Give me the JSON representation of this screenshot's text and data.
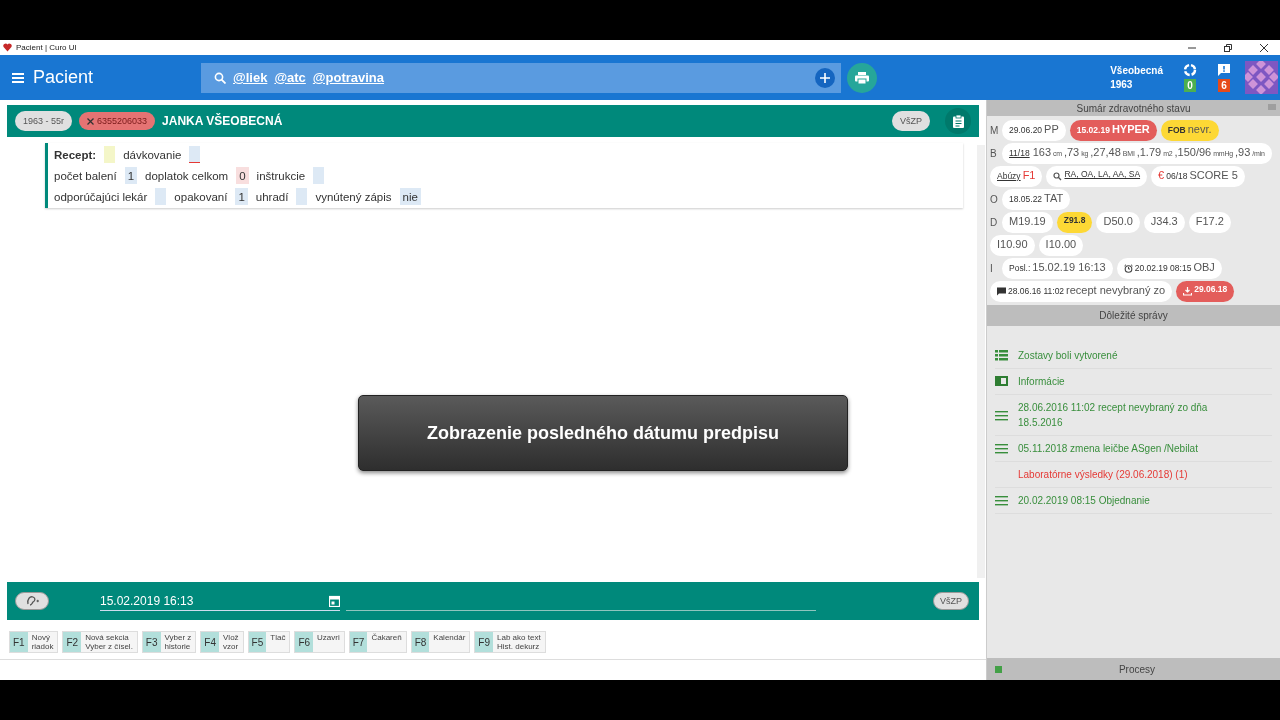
{
  "window": {
    "title": "Pacient | Curo UI"
  },
  "header": {
    "title": "Pacient",
    "search_tags": [
      "@liek",
      "@atc",
      "@potravina"
    ],
    "user_name": "Všeobecná",
    "user_year": "1963",
    "sync_count": "0",
    "message_count": "6"
  },
  "patient": {
    "age": "1963 - 55r",
    "id": "6355206033",
    "name": "JANKA VŠEOBECNÁ",
    "insurer": "VšZP"
  },
  "recept": [
    [
      {
        "label": "Recept:",
        "strong": true,
        "color": "#f4f6c8"
      },
      {
        "label": "dávkovanie",
        "strong": false,
        "color": "#dde9f5",
        "error": true
      }
    ],
    [
      {
        "label": "počet balení",
        "strong": false,
        "value": "1",
        "color": "#dde9f5"
      },
      {
        "label": "doplatok celkom",
        "strong": false,
        "value": "0",
        "color": "#f8dede"
      },
      {
        "label": "inštrukcie",
        "strong": false,
        "color": "#dde9f5"
      }
    ],
    [
      {
        "label": "odporúčajúci lekár",
        "strong": false,
        "color": "#dde9f5"
      },
      {
        "label": "opakovaní",
        "strong": false,
        "value": "1",
        "color": "#dde9f5"
      },
      {
        "label": "uhradí",
        "strong": false,
        "color": "#dde9f5"
      },
      {
        "label": "vynútený zápis",
        "strong": false,
        "value": "nie",
        "color": "#dde9f5"
      }
    ]
  ],
  "toast": "Zobrazenie posledného dátumu predpisu",
  "footer": {
    "date": "15.02.2019 16:13",
    "insurer": "VšZP"
  },
  "function_keys": [
    {
      "key": "F1",
      "lines": [
        "Nový",
        "riadok"
      ]
    },
    {
      "key": "F2",
      "lines": [
        "Nová sekcia",
        "Vyber z čísel."
      ]
    },
    {
      "key": "F3",
      "lines": [
        "Vyber z",
        "historie"
      ]
    },
    {
      "key": "F4",
      "lines": [
        "Vlož",
        "vzor"
      ]
    },
    {
      "key": "F5",
      "lines": [
        "Tlač"
      ]
    },
    {
      "key": "F6",
      "lines": [
        "Uzavri"
      ]
    },
    {
      "key": "F7",
      "lines": [
        "Čakareň"
      ]
    },
    {
      "key": "F8",
      "lines": [
        "Kalendár"
      ]
    },
    {
      "key": "F9",
      "lines": [
        "Lab ako text",
        "Hist. dekurz"
      ]
    }
  ],
  "summary": {
    "title": "Sumár zdravotného stavu",
    "rows": [
      {
        "letter": "M",
        "chips": [
          {
            "kind": "plain",
            "parts": [
              {
                "text": "29.06.20",
                "kind": "minor"
              },
              {
                "text": "PP",
                "kind": "major"
              }
            ]
          },
          {
            "kind": "alert",
            "parts": [
              {
                "text": "15.02.19",
                "kind": "minor"
              },
              {
                "text": "HYPER",
                "kind": "strong"
              }
            ]
          },
          {
            "kind": "warning",
            "parts": [
              {
                "text": "FOB",
                "kind": "minor"
              },
              {
                "text": "nevr.",
                "kind": "major"
              }
            ]
          }
        ]
      },
      {
        "letter": "B",
        "chips": [
          {
            "kind": "plain",
            "parts": [
              {
                "text": "11/18",
                "kind": "link"
              },
              {
                "text": "163",
                "kind": "major"
              },
              {
                "text": "cm",
                "kind": "unit"
              },
              {
                "text": ",73",
                "kind": "major"
              },
              {
                "text": "kg",
                "kind": "unit"
              },
              {
                "text": ",27,48",
                "kind": "major"
              },
              {
                "text": "BMI",
                "kind": "unit"
              },
              {
                "text": ",1.79",
                "kind": "major"
              },
              {
                "text": "m2",
                "kind": "unit"
              },
              {
                "text": ",150/96",
                "kind": "major"
              },
              {
                "text": "mmHg",
                "kind": "unit"
              },
              {
                "text": ",93",
                "kind": "major"
              },
              {
                "text": "/min",
                "kind": "unit"
              }
            ]
          }
        ]
      },
      {
        "chips": [
          {
            "kind": "plain",
            "parts": [
              {
                "text": "Abúzy",
                "kind": "link"
              },
              {
                "text": "F1",
                "kind": "alert"
              }
            ]
          },
          {
            "kind": "search",
            "parts": [
              {
                "text": "RA, OA, LA, AA, SA",
                "kind": "link"
              }
            ]
          },
          {
            "kind": "plain",
            "parts": [
              {
                "text": "€",
                "kind": "alert"
              },
              {
                "text": "06/18",
                "kind": "minor"
              },
              {
                "text": "SCORE 5",
                "kind": "major"
              }
            ]
          }
        ]
      },
      {
        "letter": "O",
        "chips": [
          {
            "kind": "plain",
            "parts": [
              {
                "text": "18.05.22",
                "kind": "minor"
              },
              {
                "text": "TAT",
                "kind": "major"
              }
            ]
          }
        ]
      },
      {
        "letter": "D",
        "chips": [
          {
            "kind": "plain",
            "parts": [
              {
                "text": "M19.19",
                "kind": "major"
              }
            ]
          },
          {
            "kind": "warning",
            "parts": [
              {
                "text": "Z91.8",
                "kind": "minor"
              }
            ]
          },
          {
            "kind": "plain",
            "parts": [
              {
                "text": "D50.0",
                "kind": "major"
              }
            ]
          },
          {
            "kind": "plain",
            "parts": [
              {
                "text": "J34.3",
                "kind": "major"
              }
            ]
          },
          {
            "kind": "plain",
            "parts": [
              {
                "text": "F17.2",
                "kind": "major"
              }
            ]
          }
        ]
      },
      {
        "chips": [
          {
            "kind": "plain",
            "parts": [
              {
                "text": "I10.90",
                "kind": "major"
              }
            ]
          },
          {
            "kind": "plain",
            "parts": [
              {
                "text": "I10.00",
                "kind": "major"
              }
            ]
          }
        ]
      },
      {
        "letter": "I",
        "chips": [
          {
            "kind": "plain",
            "parts": [
              {
                "text": "Posl.:",
                "kind": "minor"
              },
              {
                "text": "15.02.19 16:13",
                "kind": "major"
              }
            ]
          },
          {
            "kind": "reminder",
            "parts": [
              {
                "text": "20.02.19 08:15",
                "kind": "minor"
              },
              {
                "text": "OBJ",
                "kind": "major"
              }
            ]
          }
        ]
      },
      {
        "chips": [
          {
            "kind": "message",
            "parts": [
              {
                "text": "28.06.16 11:02",
                "kind": "minor"
              },
              {
                "text": "recept nevybraný zo",
                "kind": "major"
              }
            ]
          },
          {
            "kind": "download",
            "parts": [
              {
                "text": "29.06.18",
                "kind": "minor"
              }
            ]
          }
        ]
      }
    ]
  },
  "messages": {
    "title": "Dôležité správy",
    "items": [
      {
        "kind": "report",
        "text": "Zostavy boli vytvorené"
      },
      {
        "kind": "info",
        "text": "Informácie"
      },
      {
        "kind": "note",
        "text": "28.06.2016 11:02 recept nevybraný zo dňa 18.5.2016"
      },
      {
        "kind": "note",
        "text": "05.11.2018 zmena leičbe ASgen /Nebilat"
      },
      {
        "kind": "alert",
        "text": "Laboratórne výsledky (29.06.2018) (1)"
      },
      {
        "kind": "note",
        "text": "20.02.2019 08:15 Objednanie"
      }
    ]
  },
  "processes": {
    "title": "Procesy"
  }
}
